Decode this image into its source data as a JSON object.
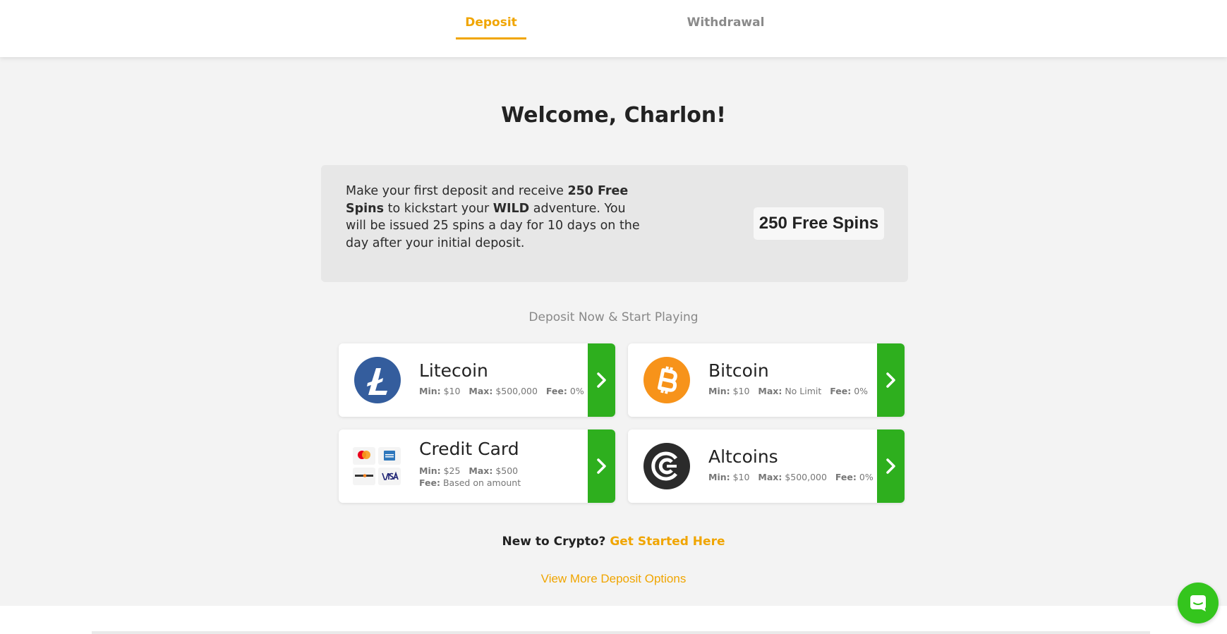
{
  "tabs": {
    "deposit": "Deposit",
    "withdrawal": "Withdrawal"
  },
  "welcome": "Welcome, Charlon!",
  "promo": {
    "text_1": "Make your first deposit and receive ",
    "bold_1": "250 Free Spins",
    "text_2": " to kickstart your ",
    "bold_2": "WILD",
    "text_3": " adventure. You will be issued 25 spins a day for 10 days on the day after your initial deposit.",
    "badge": "250 Free Spins"
  },
  "subhead": "Deposit Now & Start Playing",
  "labels": {
    "min": "Min:",
    "max": "Max:",
    "fee": "Fee:"
  },
  "methods": {
    "litecoin": {
      "name": "Litecoin",
      "min": "$10",
      "max": "$500,000",
      "fee": "0%",
      "icon": "litecoin-icon"
    },
    "bitcoin": {
      "name": "Bitcoin",
      "min": "$10",
      "max": "No Limit",
      "fee": "0%",
      "icon": "bitcoin-icon"
    },
    "credit_card": {
      "name": "Credit Card",
      "min": "$25",
      "max": "$500",
      "fee": "Based on amount",
      "icon": "credit-card-logos-icon"
    },
    "altcoins": {
      "name": "Altcoins",
      "min": "$10",
      "max": "$500,000",
      "fee": "0%",
      "icon": "altcoins-icon"
    }
  },
  "new_to_crypto": "New to Crypto?",
  "get_started": "Get Started Here",
  "more_options": "View More Deposit Options",
  "colors": {
    "accent": "#f0a500",
    "green": "#2eaf1e",
    "litecoin": "#345d9d",
    "bitcoin": "#f7931a",
    "chat": "#34c51d"
  }
}
